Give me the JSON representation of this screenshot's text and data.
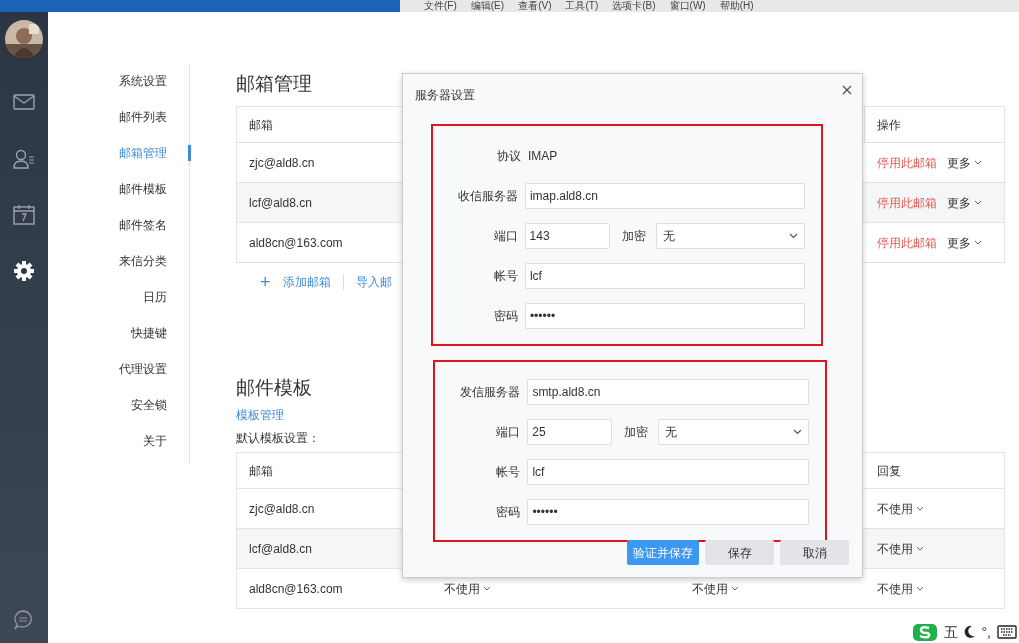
{
  "menu_bar": [
    "文件(F)",
    "编辑(E)",
    "查看(V)",
    "工具(T)",
    "选项卡(B)",
    "窗口(W)",
    "帮助(H)"
  ],
  "sidebar": {
    "items": [
      {
        "kind": "mail",
        "selected": false
      },
      {
        "kind": "contacts",
        "selected": false
      },
      {
        "kind": "calendar",
        "selected": false
      },
      {
        "kind": "settings",
        "selected": true
      }
    ]
  },
  "settings_nav": {
    "items": [
      {
        "label": "系统设置",
        "selected": false
      },
      {
        "label": "邮件列表",
        "selected": false
      },
      {
        "label": "邮箱管理",
        "selected": true
      },
      {
        "label": "邮件模板",
        "selected": false
      },
      {
        "label": "邮件签名",
        "selected": false
      },
      {
        "label": "来信分类",
        "selected": false
      },
      {
        "label": "日历",
        "selected": false
      },
      {
        "label": "快捷键",
        "selected": false
      },
      {
        "label": "代理设置",
        "selected": false
      },
      {
        "label": "安全锁",
        "selected": false
      },
      {
        "label": "关于",
        "selected": false
      }
    ]
  },
  "mailbox_section": {
    "title": "邮箱管理",
    "table": {
      "columns": [
        "邮箱",
        "操作"
      ],
      "rows": [
        {
          "email": "zjc@ald8.cn",
          "action": "停用此邮箱",
          "more": "更多"
        },
        {
          "email": "lcf@ald8.cn",
          "action": "停用此邮箱",
          "more": "更多"
        },
        {
          "email": "ald8cn@163.com",
          "action": "停用此邮箱",
          "more": "更多"
        }
      ]
    },
    "add_icon": "+",
    "links": [
      "添加邮箱",
      "导入邮"
    ]
  },
  "template_section": {
    "title": "邮件模板",
    "link": "模板管理",
    "subtitle": "默认模板设置：",
    "table": {
      "columns": [
        "邮箱",
        "回复"
      ],
      "rows": [
        {
          "email": "zjc@ald8.cn",
          "reply": "不使用"
        },
        {
          "email": "lcf@ald8.cn",
          "reply": "不使用"
        },
        {
          "email": "ald8cn@163.com",
          "column_2": "不使用",
          "column_3": "不使用",
          "reply": "不使用"
        }
      ]
    }
  },
  "dialog": {
    "title": "服务器设置",
    "groups": [
      {
        "fields": [
          {
            "kind": "static",
            "label": "协议",
            "value": "IMAP"
          },
          {
            "kind": "input",
            "label": "收信服务器",
            "value": "imap.ald8.cn"
          },
          {
            "kind": "port",
            "label": "端口",
            "value": "143",
            "encryption_label": "加密",
            "encryption": "无"
          },
          {
            "kind": "input",
            "label": "帐号",
            "value": "lcf"
          },
          {
            "kind": "input",
            "label": "密码",
            "value": "••••••"
          }
        ]
      },
      {
        "fields": [
          {
            "kind": "input",
            "label": "发信服务器",
            "value": "smtp.ald8.cn"
          },
          {
            "kind": "port",
            "label": "端口",
            "value": "25",
            "encryption_label": "加密",
            "encryption": "无"
          },
          {
            "kind": "input",
            "label": "帐号",
            "value": "lcf"
          },
          {
            "kind": "input",
            "label": "密码",
            "value": "••••••"
          }
        ]
      }
    ],
    "buttons": [
      {
        "label": "验证并保存",
        "kind": "primary"
      },
      {
        "label": "保存",
        "kind": "secondary"
      },
      {
        "label": "取消",
        "kind": "secondary"
      }
    ]
  },
  "ime_bar": {
    "items": [
      "五",
      "°,"
    ]
  }
}
